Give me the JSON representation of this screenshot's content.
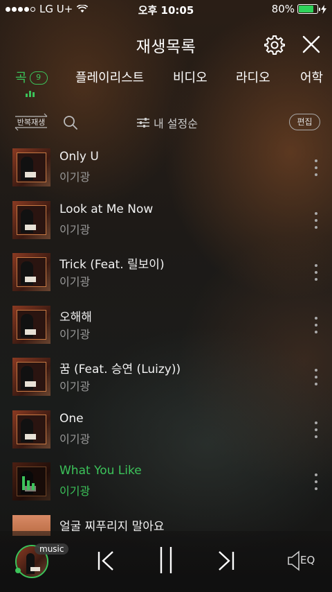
{
  "status_bar": {
    "carrier": "LG U+",
    "time": "오후 10:05",
    "battery": "80%",
    "battery_level": 0.8
  },
  "header": {
    "title": "재생목록",
    "settings_icon": "gear-icon",
    "close_icon": "close-icon"
  },
  "tabs": [
    {
      "label": "곡",
      "count": "9",
      "active": true
    },
    {
      "label": "플레이리스트",
      "active": false
    },
    {
      "label": "비디오",
      "active": false
    },
    {
      "label": "라디오",
      "active": false
    },
    {
      "label": "어학",
      "active": false
    }
  ],
  "toolbar": {
    "repeat_label": "반복재생",
    "sort_label": "내 설정순",
    "edit_label": "편집"
  },
  "songs": [
    {
      "title": "Only U",
      "artist": "이기광",
      "playing": false
    },
    {
      "title": "Look at Me Now",
      "artist": "이기광",
      "playing": false
    },
    {
      "title": "Trick (Feat. 릴보이)",
      "artist": "이기광",
      "playing": false
    },
    {
      "title": "오해해",
      "artist": "이기광",
      "playing": false
    },
    {
      "title": "꿈 (Feat. 승연 (Luizy))",
      "artist": "이기광",
      "playing": false
    },
    {
      "title": "One",
      "artist": "이기광",
      "playing": false
    },
    {
      "title": "What You Like",
      "artist": "이기광",
      "playing": true
    },
    {
      "title": "얼굴 찌푸리지 말아요",
      "artist": "",
      "playing": false
    }
  ],
  "player": {
    "badge": "music",
    "eq_label": "EQ"
  },
  "colors": {
    "accent": "#3cc35a",
    "text": "#f2f2f2",
    "subtext": "#9a9a9a"
  }
}
